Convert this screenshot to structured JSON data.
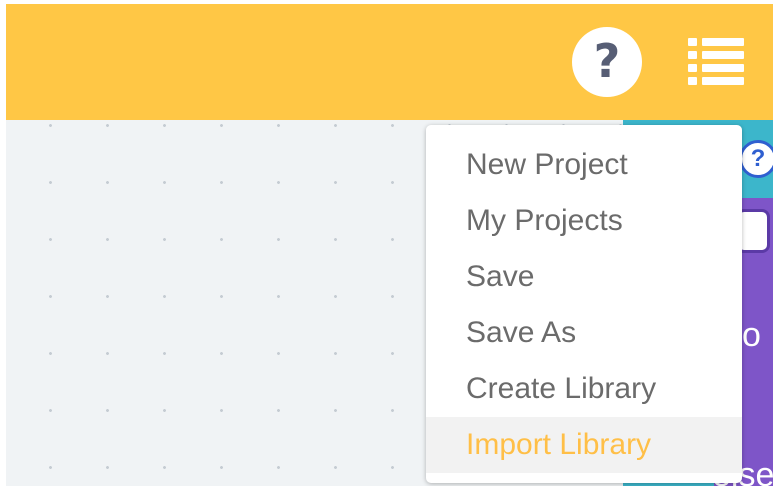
{
  "header": {
    "help_button_label": "?"
  },
  "menu": {
    "items": [
      {
        "label": "New Project"
      },
      {
        "label": "My Projects"
      },
      {
        "label": "Save"
      },
      {
        "label": "Save As"
      },
      {
        "label": "Create Library"
      },
      {
        "label": "Import Library",
        "highlighted": true
      }
    ]
  },
  "blocks": {
    "help_badge": "?",
    "text_fragment_1": "o",
    "text_fragment_2": "else"
  },
  "colors": {
    "topbar": "#ffc745",
    "workspace": "#f0f3f5",
    "highlight_text": "#ffbf47",
    "menu_text": "#6b6b6b",
    "block_cyan": "#3cb6cb",
    "block_purple": "#7e55c8"
  },
  "icons": {
    "help": "help-icon",
    "menu": "list-menu-icon"
  }
}
